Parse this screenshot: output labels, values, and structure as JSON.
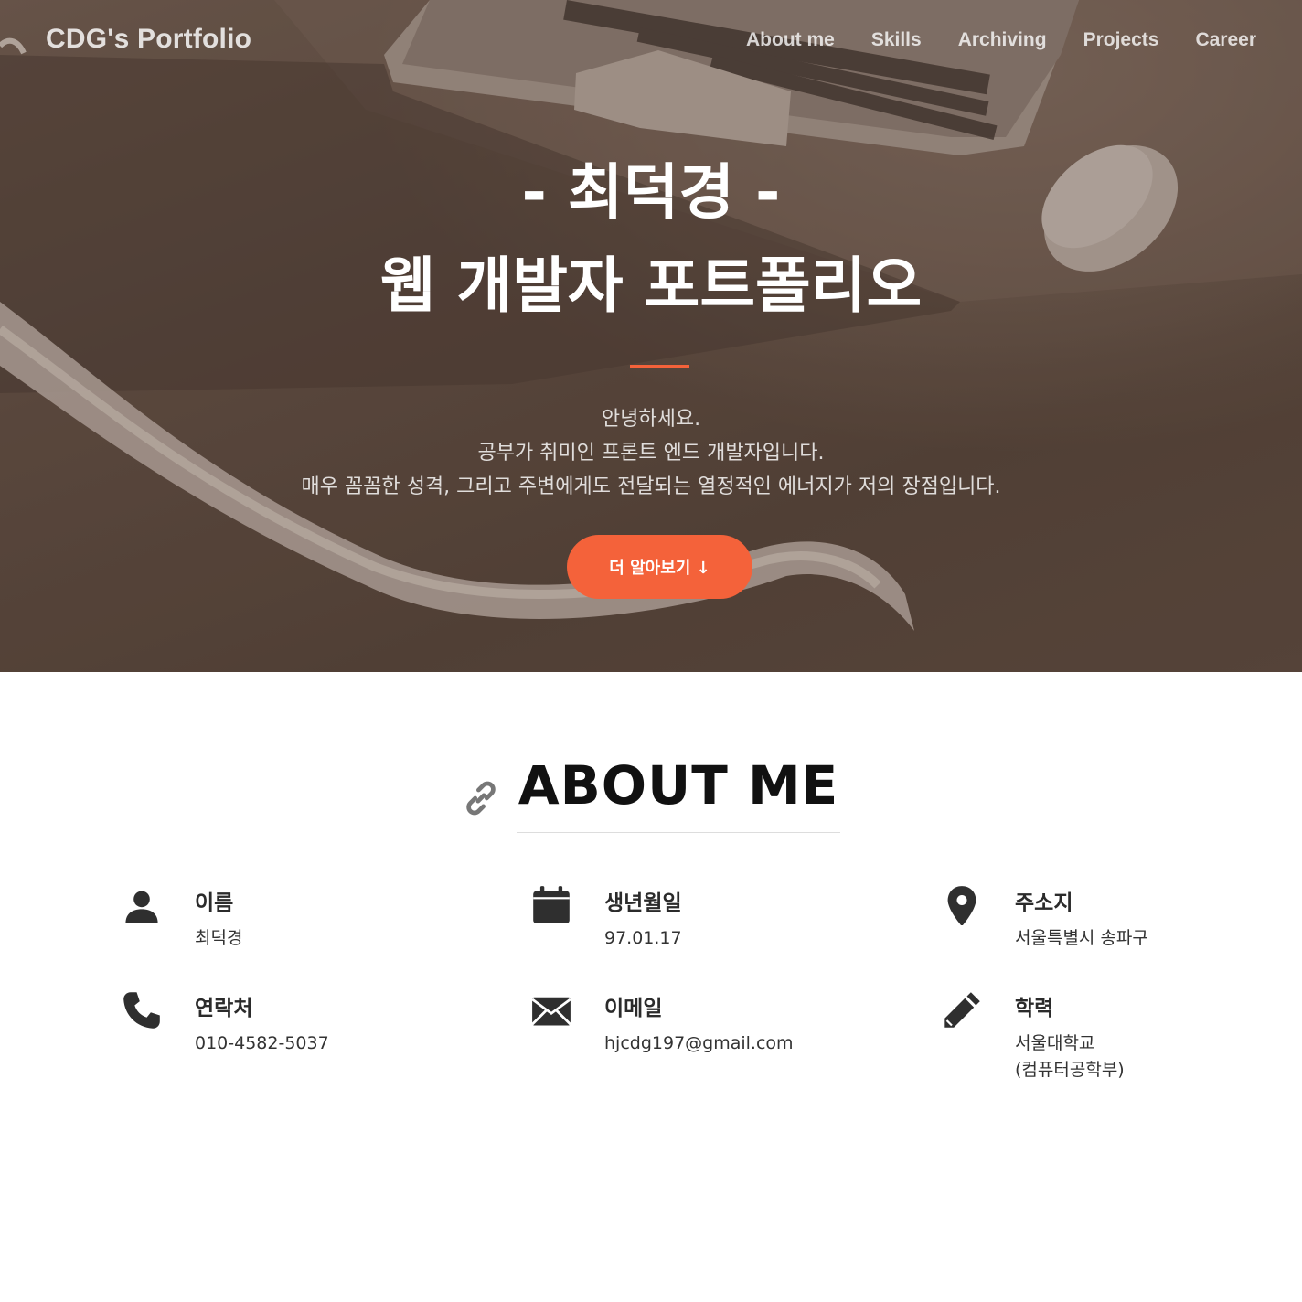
{
  "nav": {
    "brand": "CDG's Portfolio",
    "links": [
      "About me",
      "Skills",
      "Archiving",
      "Projects",
      "Career"
    ]
  },
  "hero": {
    "title_line1": "- 최덕경 -",
    "title_line2": "웹 개발자 포트폴리오",
    "intro": [
      "안녕하세요.",
      "공부가 취미인 프론트 엔드 개발자입니다.",
      "매우 꼼꼼한 성격, 그리고 주변에게도 전달되는 열정적인 에너지가 저의 장점입니다."
    ],
    "cta_label": "더 알아보기 ↓",
    "accent_color": "#f4623a"
  },
  "about": {
    "title": "ABOUT ME",
    "title_icon": "link-icon",
    "items": [
      {
        "icon": "user-icon",
        "label": "이름",
        "value": "최덕경"
      },
      {
        "icon": "calendar-icon",
        "label": "생년월일",
        "value": "97.01.17"
      },
      {
        "icon": "map-marker-icon",
        "label": "주소지",
        "value": "서울특별시 송파구"
      },
      {
        "icon": "phone-icon",
        "label": "연락처",
        "value": "010-4582-5037"
      },
      {
        "icon": "envelope-icon",
        "label": "이메일",
        "value": "hjcdg197@gmail.com"
      },
      {
        "icon": "pencil-icon",
        "label": "학력",
        "value": "서울대학교",
        "value2": "(컴퓨터공학부)"
      }
    ]
  }
}
